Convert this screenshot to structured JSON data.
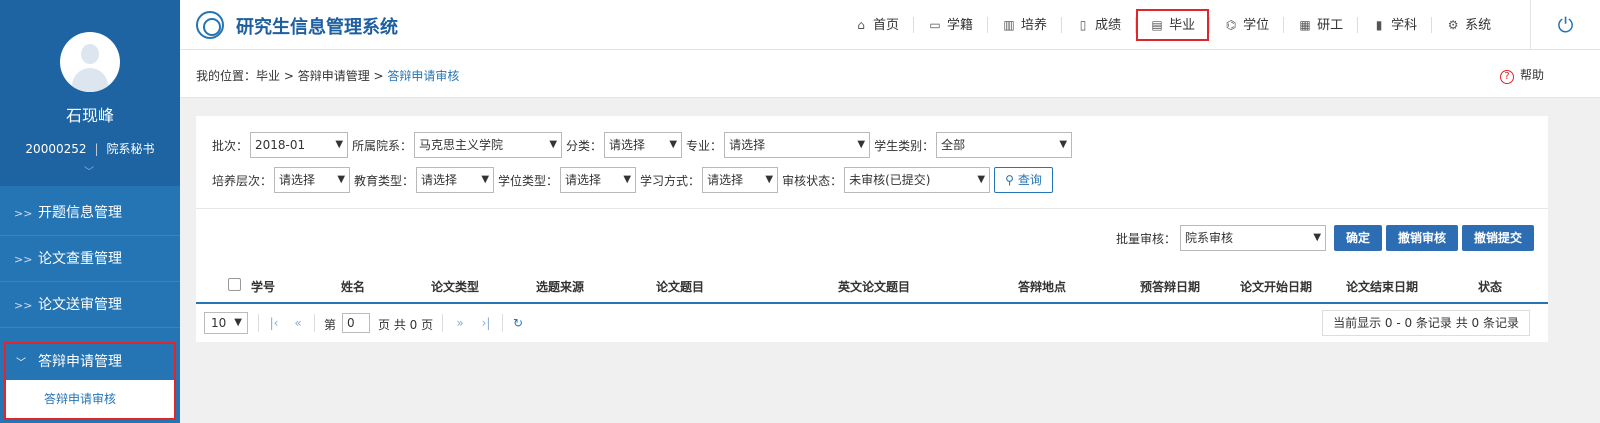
{
  "user": {
    "name": "石现峰",
    "id": "20000252",
    "role": "院系秘书"
  },
  "sidebar": {
    "items": [
      {
        "label": "开题信息管理"
      },
      {
        "label": "论文查重管理"
      },
      {
        "label": "论文送审管理"
      }
    ],
    "open": {
      "label": "答辩申请管理",
      "sub": "答辩申请审核"
    }
  },
  "header": {
    "title": "研究生信息管理系统",
    "nav": [
      {
        "label": "首页",
        "icon": "home-icon"
      },
      {
        "label": "学籍",
        "icon": "id-card-icon"
      },
      {
        "label": "培养",
        "icon": "book-icon"
      },
      {
        "label": "成绩",
        "icon": "document-icon"
      },
      {
        "label": "毕业",
        "icon": "graduation-doc-icon"
      },
      {
        "label": "学位",
        "icon": "mortarboard-icon"
      },
      {
        "label": "研工",
        "icon": "grid-icon"
      },
      {
        "label": "学科",
        "icon": "bar-chart-icon"
      },
      {
        "label": "系统",
        "icon": "gear-icon"
      }
    ],
    "selected": "毕业",
    "accent": "#e0252b"
  },
  "breadcrumb": {
    "prefix": "我的位置：",
    "path": "毕业 > 答辩申请管理 > ",
    "current": "答辩申请审核",
    "help": "帮助"
  },
  "filters": {
    "batch_label": "批次：",
    "batch_value": "2018-01",
    "dept_label": "所属院系：",
    "dept_value": "马克思主义学院",
    "category_label": "分类：",
    "category_value": "请选择",
    "major_label": "专业：",
    "major_value": "请选择",
    "stype_label": "学生类别：",
    "stype_value": "全部",
    "level_label": "培养层次：",
    "level_value": "请选择",
    "edu_label": "教育类型：",
    "edu_value": "请选择",
    "degree_label": "学位类型：",
    "degree_value": "请选择",
    "mode_label": "学习方式：",
    "mode_value": "请选择",
    "status_label": "审核状态：",
    "status_value": "未审核(已提交)",
    "query_label": "查询"
  },
  "batch_ops": {
    "label": "批量审核：",
    "value": "院系审核",
    "confirm": "确定",
    "revoke_review": "撤销审核",
    "revoke_submit": "撤销提交"
  },
  "table": {
    "columns": [
      "学号",
      "姓名",
      "论文类型",
      "选题来源",
      "论文题目",
      "英文论文题目",
      "答辩地点",
      "预答辩日期",
      "论文开始日期",
      "论文结束日期",
      "状态"
    ]
  },
  "pager": {
    "size": "10",
    "page_prefix": "第",
    "page_value": "0",
    "page_suffix": "页 共 0 页",
    "info": "当前显示 0 - 0 条记录 共 0 条记录"
  }
}
